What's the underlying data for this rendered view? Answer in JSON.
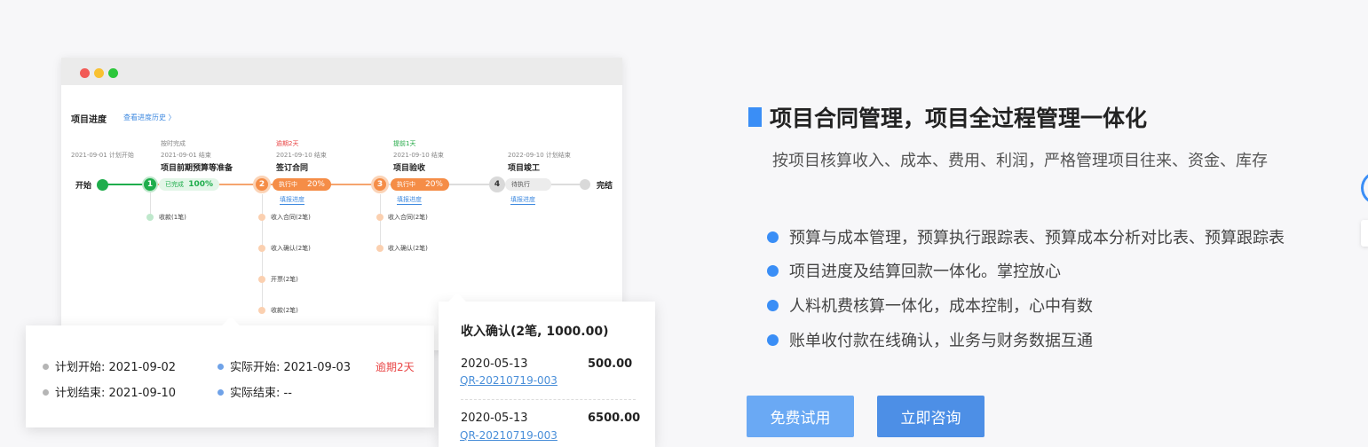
{
  "window": {
    "title": "项目进度",
    "history_link": "查看进度历史 〉"
  },
  "timeline": {
    "start_label": "开始",
    "end_label": "完结",
    "stages": [
      {
        "number": "1",
        "status_note": "按时完成",
        "status_color": "#888888",
        "date_note": "2021-09-01 结束",
        "name": "项目前期预算等准备",
        "pill_label": "已完成",
        "pill_pct": "100%",
        "color": "#1fad4c"
      },
      {
        "number": "2",
        "status_note": "逾期2天",
        "status_color": "#e94545",
        "date_note": "2021-09-10 结束",
        "name": "签订合同",
        "pill_label": "执行中",
        "pill_pct": "20%",
        "fill_link": "填报进度",
        "color": "#f58d47"
      },
      {
        "number": "3",
        "status_note": "提前1天",
        "status_color": "#22a845",
        "date_note": "2021-09-10 结束",
        "name": "项目验收",
        "pill_label": "执行中",
        "pill_pct": "20%",
        "fill_link": "填报进度",
        "color": "#f58d47"
      },
      {
        "number": "4",
        "date_note": "2022-09-10 计划结束",
        "name": "项目竣工",
        "pill_label": "待执行",
        "fill_link": "填报进度",
        "color": "#d9d9d9"
      }
    ],
    "plan_start_note": "2021-09-01 计划开始",
    "stage1_sub": [
      "收款(1笔)"
    ],
    "stage2_sub": [
      "收入合同(2笔)",
      "收入确认(2笔)",
      "开票(2笔)",
      "收款(2笔)"
    ],
    "stage3_sub": [
      "收入合同(2笔)",
      "收入确认(2笔)"
    ]
  },
  "schedule_card": {
    "plan_start": "计划开始: 2021-09-02",
    "plan_end": "计划结束: 2021-09-10",
    "actual_start": "实际开始: 2021-09-03",
    "actual_end": "实际结束: --",
    "overdue": "逾期2天"
  },
  "income_card": {
    "title": "收入确认(2笔, 1000.00)",
    "rows": [
      {
        "date": "2020-05-13",
        "amount": "500.00",
        "code": "QR-20210719-003"
      },
      {
        "date": "2020-05-13",
        "amount": "6500.00",
        "code": "QR-20210719-003"
      }
    ]
  },
  "info": {
    "heading": "项目合同管理，项目全过程管理一体化",
    "subheading": "按项目核算收入、成本、费用、利润，严格管理项目往来、资金、库存",
    "features": [
      "预算与成本管理，预算执行跟踪表、预算成本分析对比表、预算跟踪表",
      "项目进度及结算回款一体化。掌控放心",
      "人料机费核算一体化，成本控制，心中有数",
      "账单收付款在线确认，业务与财务数据互通"
    ],
    "trial_button": "免费试用",
    "consult_button": "立即咨询"
  },
  "colors": {
    "accent": "#3a8ef6",
    "done": "#1fad4c",
    "in_progress": "#f58d47",
    "overdue": "#e94545"
  }
}
